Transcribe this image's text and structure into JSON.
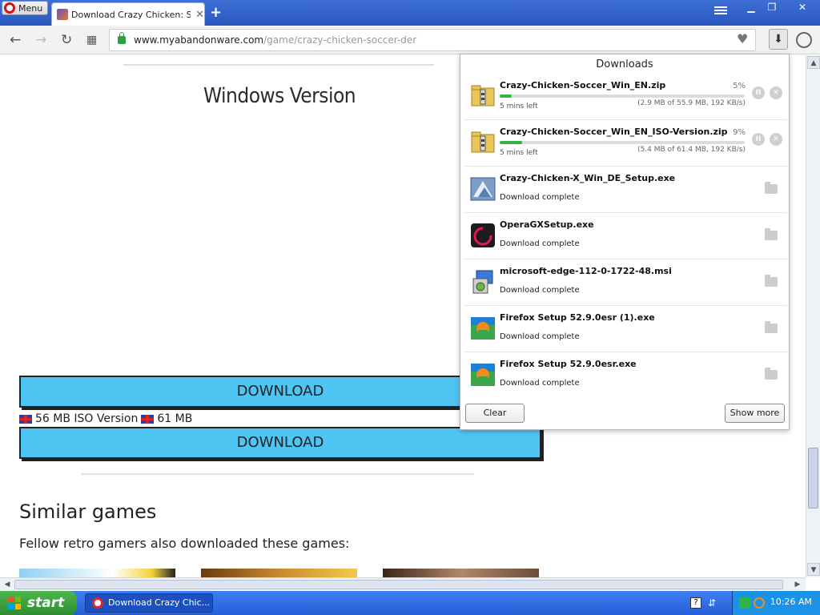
{
  "browser": {
    "menu_label": "Menu",
    "tab_title": "Download Crazy Chicken: Soccer",
    "url_domain": "www.myabandonware.com",
    "url_path": "/game/crazy-chicken-soccer-der"
  },
  "page": {
    "section_title": "Windows Version",
    "download_label_1": "DOWNLOAD",
    "iso_text_1": "56 MB ISO Version",
    "iso_text_2": "61 MB",
    "download_label_2": "DOWNLOAD",
    "similar_title": "Similar games",
    "similar_sub": "Fellow retro gamers also downloaded these games:"
  },
  "downloads": {
    "title": "Downloads",
    "clear_label": "Clear",
    "show_more_label": "Show more",
    "items": [
      {
        "name": "Crazy-Chicken-Soccer_Win_EN.zip",
        "percent": "5%",
        "progress": 0.05,
        "time_left": "5 mins left",
        "size": "(2.9 MB of 55.9 MB, 192 KB/s)",
        "icon": "zip-archive-icon"
      },
      {
        "name": "Crazy-Chicken-Soccer_Win_EN_ISO-Version.zip",
        "percent": "9%",
        "progress": 0.09,
        "time_left": "5 mins left",
        "size": "(5.4 MB of 61.4 MB, 192 KB/s)",
        "icon": "zip-archive-icon"
      },
      {
        "name": "Crazy-Chicken-X_Win_DE_Setup.exe",
        "status": "Download complete",
        "icon": "installer-icon"
      },
      {
        "name": "OperaGXSetup.exe",
        "status": "Download complete",
        "icon": "opera-gx-icon"
      },
      {
        "name": "microsoft-edge-112-0-1722-48.msi",
        "status": "Download complete",
        "icon": "msi-installer-icon"
      },
      {
        "name": "Firefox Setup 52.9.0esr (1).exe",
        "status": "Download complete",
        "icon": "firefox-setup-icon"
      },
      {
        "name": "Firefox Setup 52.9.0esr.exe",
        "status": "Download complete",
        "icon": "firefox-setup-icon"
      }
    ]
  },
  "taskbar": {
    "start_label": "start",
    "task_label": "Download Crazy Chic...",
    "clock": "10:26 AM"
  },
  "colors": {
    "download_button": "#4ec5f3",
    "progress": "#2fb545",
    "taskbar": "#245fd8"
  }
}
